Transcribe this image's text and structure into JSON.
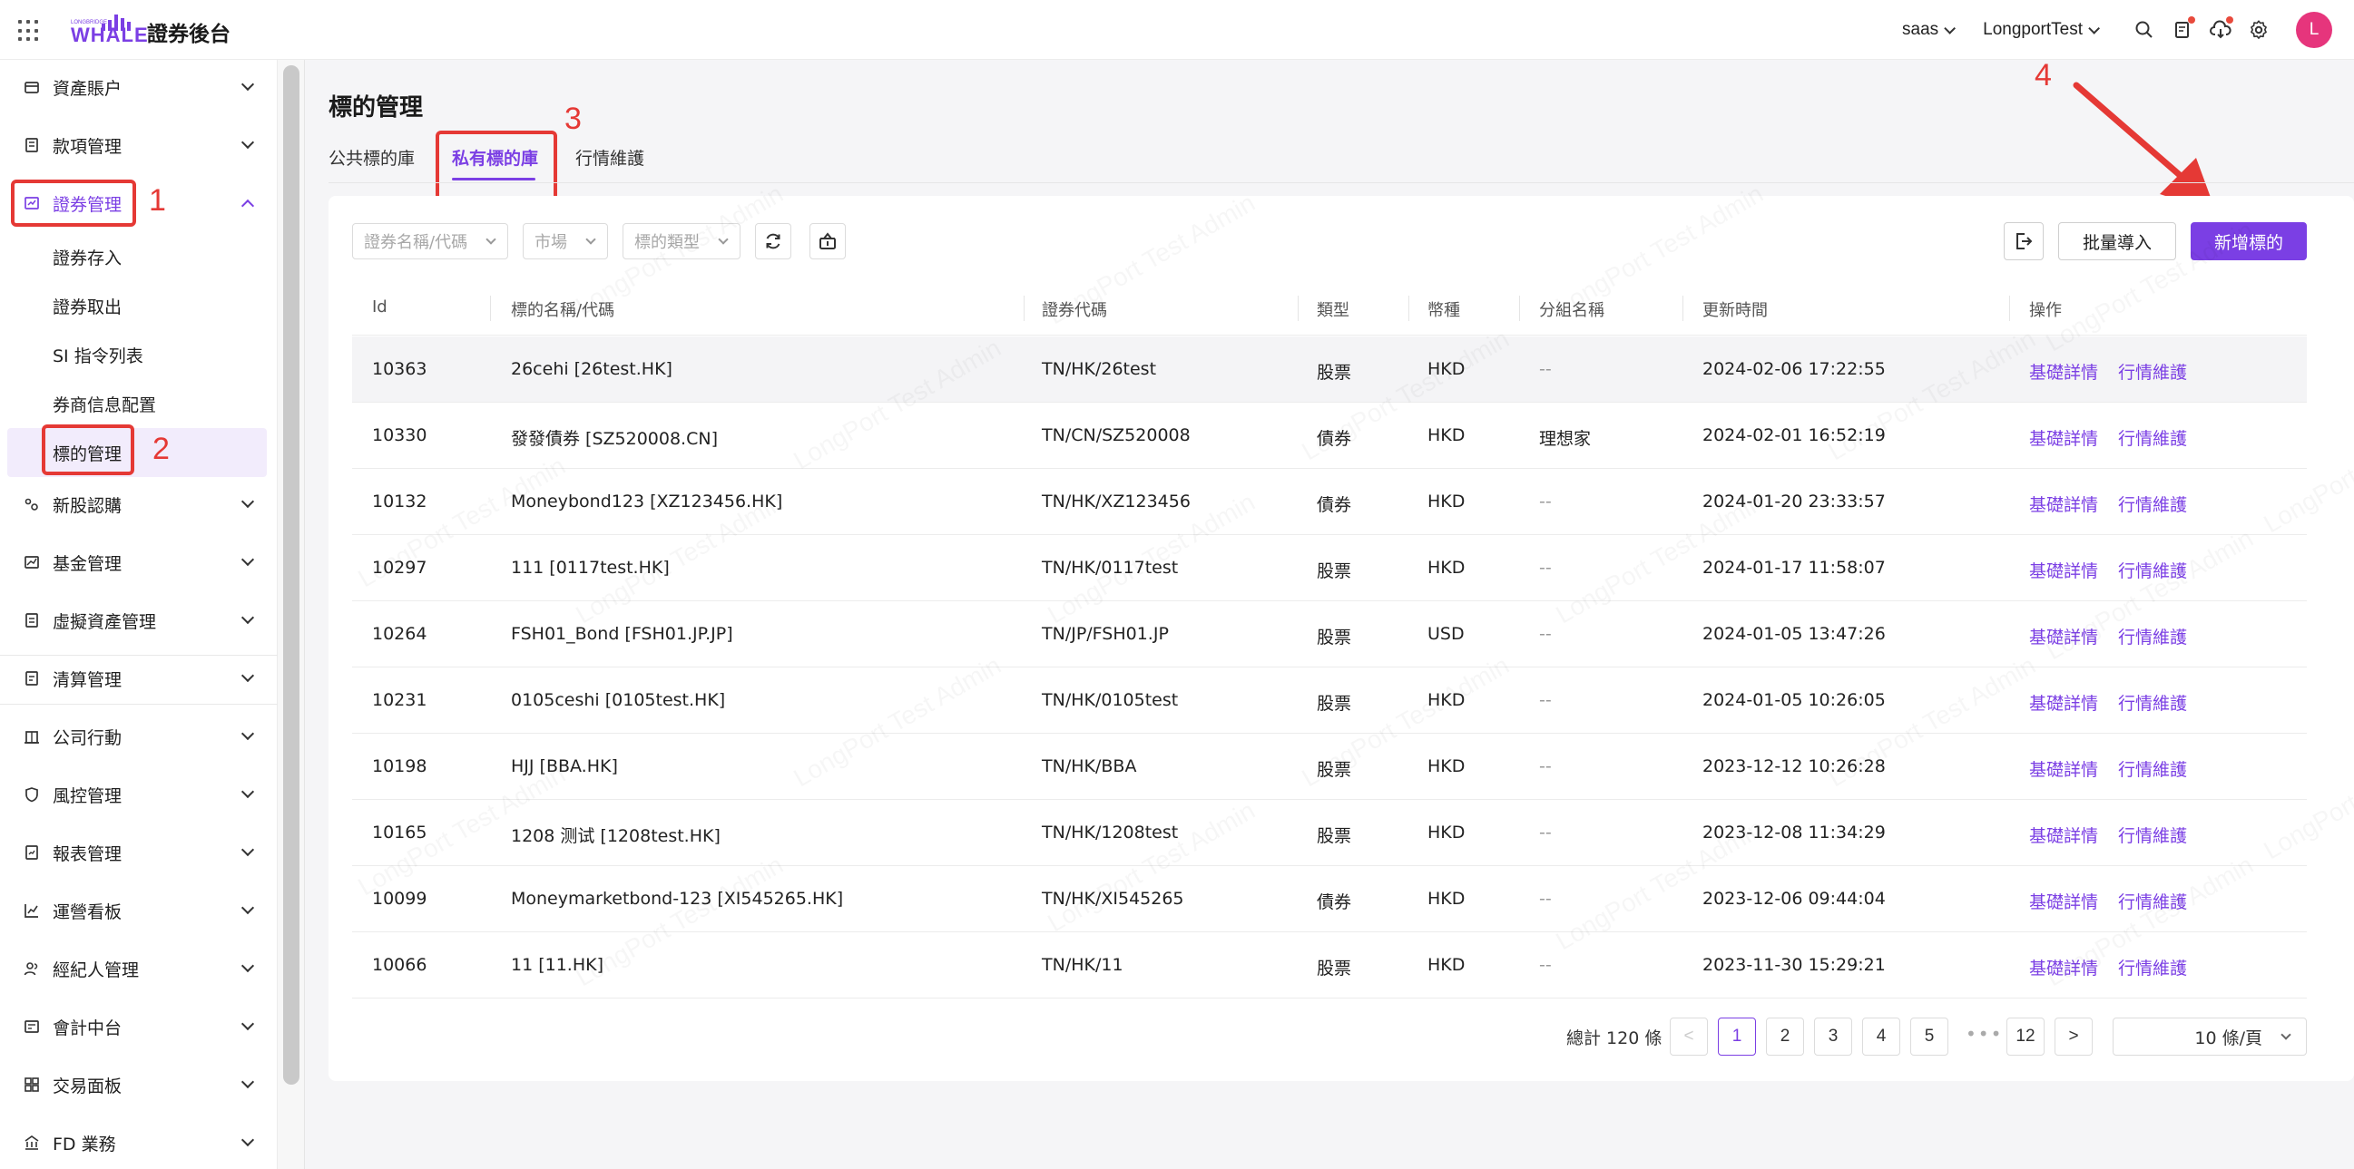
{
  "app": {
    "logo_text": "WHALE",
    "logo_tagline": "LONGBRIDGE",
    "title": "證券後台"
  },
  "header": {
    "tenant": "saas",
    "user": "LongportTest",
    "avatar_letter": "L",
    "icons": [
      "search-icon",
      "bill-icon",
      "cloud-download-icon",
      "settings-icon"
    ]
  },
  "sidebar": {
    "items": [
      {
        "label": "資產賬户",
        "icon": "wallet-icon"
      },
      {
        "label": "款項管理",
        "icon": "document-icon"
      },
      {
        "label": "證券管理",
        "icon": "chart-box-icon",
        "expanded": true
      },
      {
        "label": "新股認購",
        "icon": "ipo-icon"
      },
      {
        "label": "基金管理",
        "icon": "fund-icon"
      },
      {
        "label": "虛擬資產管理",
        "icon": "virtual-asset-icon"
      },
      {
        "label": "清算管理",
        "icon": "clearing-icon"
      },
      {
        "label": "公司行動",
        "icon": "building-icon"
      },
      {
        "label": "風控管理",
        "icon": "shield-icon"
      },
      {
        "label": "報表管理",
        "icon": "report-icon"
      },
      {
        "label": "運營看板",
        "icon": "line-chart-icon"
      },
      {
        "label": "經紀人管理",
        "icon": "users-icon"
      },
      {
        "label": "會計中台",
        "icon": "accounting-icon"
      },
      {
        "label": "交易面板",
        "icon": "dashboard-icon"
      },
      {
        "label": "FD 業務",
        "icon": "bank-icon"
      }
    ],
    "sub_items": [
      "證券存入",
      "證券取出",
      "SI 指令列表",
      "券商信息配置",
      "標的管理"
    ]
  },
  "annotations": [
    "1",
    "2",
    "3",
    "4"
  ],
  "page": {
    "title": "標的管理",
    "tabs": [
      "公共標的庫",
      "私有標的庫",
      "行情維護"
    ],
    "active_tab": "私有標的庫"
  },
  "filters": {
    "name_placeholder": "證券名稱/代碼",
    "market_placeholder": "市場",
    "type_placeholder": "標的類型"
  },
  "actions": {
    "export_icon": "export-icon",
    "batch_import": "批量導入",
    "add": "新增標的"
  },
  "table": {
    "columns": [
      "Id",
      "標的名稱/代碼",
      "證券代碼",
      "類型",
      "幣種",
      "分組名稱",
      "更新時間",
      "操作"
    ],
    "rows": [
      [
        "10363",
        "26cehi [26test.HK]",
        "TN/HK/26test",
        "股票",
        "HKD",
        "--",
        "2024-02-06 17:22:55"
      ],
      [
        "10330",
        "發發債券 [SZ520008.CN]",
        "TN/CN/SZ520008",
        "債券",
        "HKD",
        "理想家",
        "2024-02-01 16:52:19"
      ],
      [
        "10132",
        "Moneybond123 [XZ123456.HK]",
        "TN/HK/XZ123456",
        "債券",
        "HKD",
        "--",
        "2024-01-20 23:33:57"
      ],
      [
        "10297",
        "111 [0117test.HK]",
        "TN/HK/0117test",
        "股票",
        "HKD",
        "--",
        "2024-01-17 11:58:07"
      ],
      [
        "10264",
        "FSH01_Bond [FSH01.JP.JP]",
        "TN/JP/FSH01.JP",
        "股票",
        "USD",
        "--",
        "2024-01-05 13:47:26"
      ],
      [
        "10231",
        "0105ceshi [0105test.HK]",
        "TN/HK/0105test",
        "股票",
        "HKD",
        "--",
        "2024-01-05 10:26:05"
      ],
      [
        "10198",
        "HJJ [BBA.HK]",
        "TN/HK/BBA",
        "股票",
        "HKD",
        "--",
        "2023-12-12 10:26:28"
      ],
      [
        "10165",
        "1208 测试 [1208test.HK]",
        "TN/HK/1208test",
        "股票",
        "HKD",
        "--",
        "2023-12-08 11:34:29"
      ],
      [
        "10099",
        "Moneymarketbond-123 [XI545265.HK]",
        "TN/HK/XI545265",
        "債券",
        "HKD",
        "--",
        "2023-12-06 09:44:04"
      ],
      [
        "10066",
        "11 [11.HK]",
        "TN/HK/11",
        "股票",
        "HKD",
        "--",
        "2023-11-30 15:29:21"
      ]
    ],
    "row_actions": [
      "基礎詳情",
      "行情維護"
    ]
  },
  "pagination": {
    "total": "總計 120 條",
    "prev": "<",
    "next": ">",
    "pages": [
      "1",
      "2",
      "3",
      "4",
      "5"
    ],
    "ellipsis": "•••",
    "last": "12",
    "current": "1",
    "page_size": "10 條/頁"
  },
  "watermark": "LongPort Test Admin",
  "colors": {
    "accent": "#7b3fe4",
    "annotation": "#e53935",
    "avatar": "#e6357c"
  }
}
